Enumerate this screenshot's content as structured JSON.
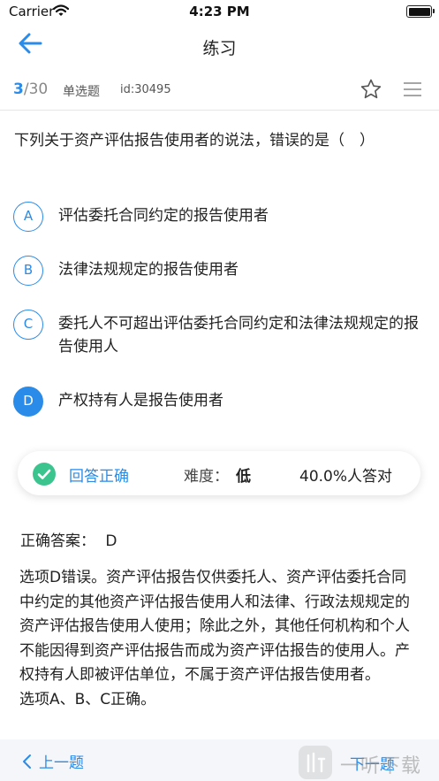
{
  "status_bar": {
    "carrier": "Carrier",
    "time": "4:23 PM"
  },
  "nav": {
    "title": "练习"
  },
  "meta": {
    "current": "3",
    "total": "/30",
    "type": "单选题",
    "id": "id:30495"
  },
  "question": {
    "text": "下列关于资产评估报告使用者的说法，错误的是（　）"
  },
  "options": [
    {
      "letter": "A",
      "text": "评估委托合同约定的报告使用者",
      "selected": false
    },
    {
      "letter": "B",
      "text": "法律法规规定的报告使用者",
      "selected": false
    },
    {
      "letter": "C",
      "text": "委托人不可超出评估委托合同约定和法律法规规定的报告使用人",
      "selected": false
    },
    {
      "letter": "D",
      "text": "产权持有人是报告使用者",
      "selected": true
    }
  ],
  "result": {
    "label": "回答正确",
    "difficulty_label": "难度：",
    "difficulty_value": "低",
    "accuracy": "40.0%人答对"
  },
  "answer": {
    "label": "正确答案：",
    "value": "D"
  },
  "analysis": {
    "text": "选项D错误。资产评估报告仅供委托人、资产评估委托合同中约定的其他资产评估报告使用人和法律、行政法规规定的资产评估报告使用人使用；除此之外，其他任何机构和个人不能因得到资产评估报告而成为资产评估报告的使用人。产权持有人即被评估单位，不属于资产评估报告使用者。",
    "text2": "选项A、B、C正确。"
  },
  "bottom": {
    "prev": "上一题",
    "next": "下一题"
  },
  "watermark": {
    "text": "一听下载"
  },
  "colors": {
    "accent": "#2a8be8",
    "success": "#3cc48f",
    "bottom_bg": "#f4f6f9"
  },
  "icons": [
    "wifi-icon",
    "battery-icon",
    "back-arrow-icon",
    "star-icon",
    "list-icon",
    "check-icon",
    "chevron-left-icon"
  ]
}
